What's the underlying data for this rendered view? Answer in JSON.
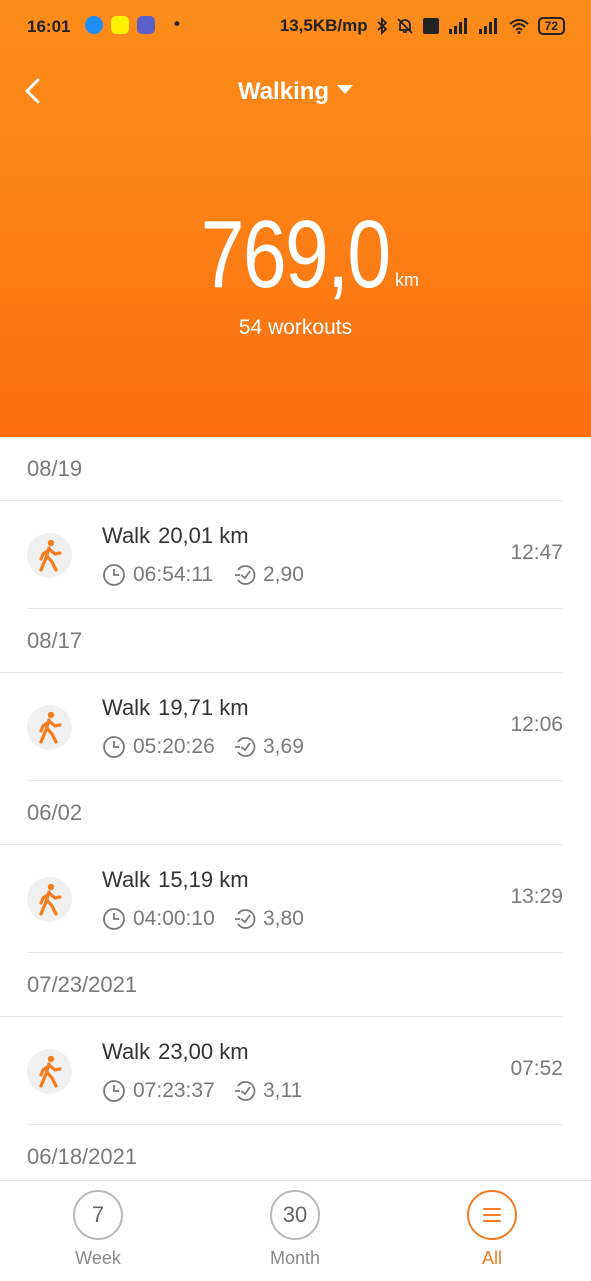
{
  "status_bar": {
    "time": "16:01",
    "dot": "•",
    "speed": "13,5KB/mp",
    "battery": "72"
  },
  "header": {
    "title": "Walking",
    "total_distance": "769,0",
    "unit": "km",
    "workouts": "54 workouts"
  },
  "sections": [
    {
      "date": "08/19",
      "workouts": [
        {
          "type": "Walk",
          "distance": "20,01 km",
          "duration": "06:54:11",
          "pace": "2,90",
          "time": "12:47"
        }
      ]
    },
    {
      "date": "08/17",
      "workouts": [
        {
          "type": "Walk",
          "distance": "19,71 km",
          "duration": "05:20:26",
          "pace": "3,69",
          "time": "12:06"
        }
      ]
    },
    {
      "date": "06/02",
      "workouts": [
        {
          "type": "Walk",
          "distance": "15,19 km",
          "duration": "04:00:10",
          "pace": "3,80",
          "time": "13:29"
        }
      ]
    },
    {
      "date": "07/23/2021",
      "workouts": [
        {
          "type": "Walk",
          "distance": "23,00 km",
          "duration": "07:23:37",
          "pace": "3,11",
          "time": "07:52"
        }
      ]
    },
    {
      "date": "06/18/2021",
      "workouts": []
    }
  ],
  "tabs": [
    {
      "number": "7",
      "label": "Week"
    },
    {
      "number": "30",
      "label": "Month"
    },
    {
      "icon": "menu-icon",
      "label": "All"
    }
  ],
  "colors": {
    "accent": "#f57c1f",
    "header_top": "#fb8c1a",
    "header_bottom": "#fa6e10"
  }
}
